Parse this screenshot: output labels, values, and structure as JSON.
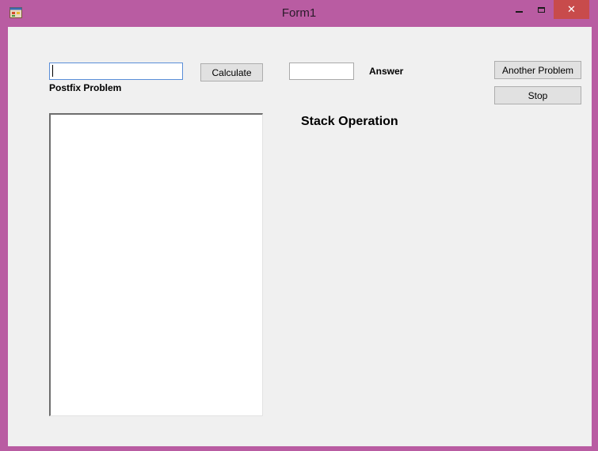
{
  "window": {
    "title": "Form1",
    "icon": "form-app-icon",
    "controls": {
      "minimize_icon": "minimize-icon",
      "maximize_icon": "maximize-icon",
      "close_icon": "close-icon",
      "close_glyph": "✕"
    },
    "accent_color": "#b95ca2",
    "close_color": "#c84b4b"
  },
  "form": {
    "problem_input": {
      "value": "",
      "placeholder": ""
    },
    "postfix_label": "Postfix Problem",
    "calculate_label": "Calculate",
    "answer_input": {
      "value": "",
      "placeholder": ""
    },
    "answer_label": "Answer",
    "another_problem_label": "Another Problem",
    "stop_label": "Stop",
    "stack_operation_label": "Stack Operation",
    "stack_items": []
  }
}
